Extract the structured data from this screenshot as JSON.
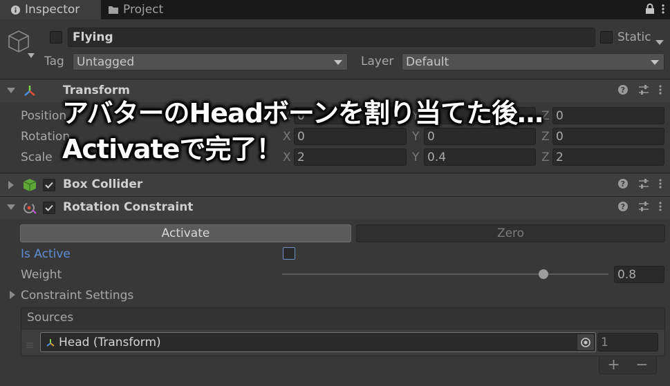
{
  "tabs": {
    "inspector": "Inspector",
    "project": "Project"
  },
  "header": {
    "name": "Flying",
    "static_label": "Static",
    "tag_label": "Tag",
    "tag_value": "Untagged",
    "layer_label": "Layer",
    "layer_value": "Default"
  },
  "transform": {
    "title": "Transform",
    "position_label": "Position",
    "rotation_label": "Rotation",
    "scale_label": "Scale",
    "axes": {
      "x": "X",
      "y": "Y",
      "z": "Z"
    },
    "position": {
      "x": "0",
      "y": "0",
      "z": "0"
    },
    "rotation": {
      "x": "0",
      "y": "0",
      "z": "0"
    },
    "scale": {
      "x": "2",
      "y": "0.4",
      "z": "2"
    }
  },
  "box_collider": {
    "title": "Box Collider"
  },
  "rotation_constraint": {
    "title": "Rotation Constraint",
    "activate_label": "Activate",
    "zero_label": "Zero",
    "is_active_label": "Is Active",
    "weight_label": "Weight",
    "weight_value": "0.8",
    "weight_fraction": 0.8,
    "constraint_settings_label": "Constraint Settings",
    "sources_label": "Sources",
    "source_value": "Head (Transform)",
    "source_weight": "1"
  },
  "caption": {
    "line1": "アバターのHeadボーンを割り当てた後…",
    "line2": "Activateで完了！"
  },
  "colors": {
    "accent_blue": "#5f8ed8",
    "panel": "#383838",
    "tabbar": "#191919"
  }
}
